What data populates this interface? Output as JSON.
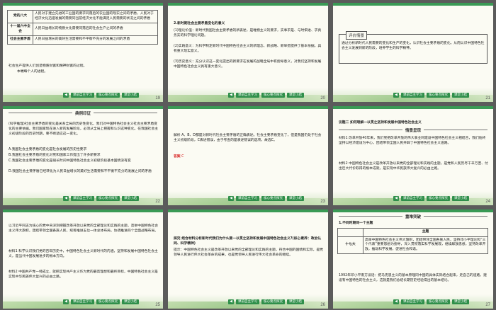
{
  "slides": [
    {
      "page": "19",
      "table": [
        {
          "head": "党的八大",
          "text": "人民对于建立先进的工业国的要求同落后的农业国的现实之间的矛盾，人民对于经济文化迅速发展的需要同当前经济文化不能满足人民需要的状况之间的矛盾"
        },
        {
          "head": "十一届六中全会",
          "text": "人民日益增长的物质文化需要同落后的社会生产之间的矛盾"
        },
        {
          "head": "社会主要矛盾",
          "text": "人民日益增长的美好生活需要和不平衡不充分的发展之间的矛盾"
        }
      ],
      "note_blue": "社会生产提供人们创造物质财富和精神财富的过程。",
      "note_red": "本端每个人的进程。"
    },
    {
      "page": "20",
      "heading": "2.新时期社会主要矛盾变化的意义",
      "lines": [
        "(1)理论价值：新时代我国社会主要矛盾的新表述，是唯物主义的要求，实事求是、与时俱进、求真务实的科学理论问题。",
        "(2)实践意义：为科学制定新时代中国特色社会主义的新理念、新战略、新举措提供了基本依据，具有重大现实意义。",
        "(3)历史意义：充分认识这一变化提出的新要求在发展的战略全局中有指导意义，对我们坚持和发展中国特色社会主义具有重大意义。"
      ]
    },
    {
      "page": "21",
      "label": "评价情景",
      "text": "通过分析新时代人民需要的变化和生产的变化，认识社会主要矛盾的变化，从而认识中国特色社会主义发展到新的阶段，培养学生的科学精神。"
    },
    {
      "page": "22",
      "ribbon": "典例印证",
      "lines": [
        "(科学推理)社会主要矛盾的变化是关系全局的历史性变化，我们对中国特色社会主义社会主要矛盾变化的主要依据。我们国家现在进入新的发展阶段，必须从全局上把握和认识这种变化，在我国社会主义初级阶段的历史时期，要不断适应这一变化。",
        "A.我国社会主要矛盾的变化是社会发展的历史性要求",
        "B.我国社会主要矛盾的变化对党和国家工作提出了许多新要求",
        "C.我国社会主要矛盾的变化是很长时间中国特色社会主义初级阶段基本国情没有变",
        "D.我国社会主要矛盾已经转化为人民日益增长的美好生活需要和不平衡不充分的发展之间的矛盾"
      ]
    },
    {
      "page": "23",
      "text_blue": "解析  A、B、D都是对新时代社会主要矛盾的正确表述。社会主要矛盾变化了，但是我国仍处于社会主义初级阶段，C表述错误，由于考查的是表述错误的选项，故选C。",
      "answer_label": "答案",
      "answer": "C"
    },
    {
      "page": "24",
      "title": "议题二  如何理解一以贯之坚持和发展中国特色社会主义",
      "ribbon": "情景呈现",
      "lines": [
        "材料1  改革开放40年来，我们党把改革开放的伟大事业同建设中国特色社会主义相结合，我们始终坚持以经济建设为中心，团结带领全国人民开辟了中国特色社会主义道路。",
        "材料2  中国特色社会主义是改革开放以来党的全部理论和实践的主题，是党和人民历尽千辛万苦、付出巨大代价取得的根本成就，是实现中华民族伟大复兴的必由之路。"
      ]
    },
    {
      "page": "25",
      "lines": [
        "以习近平同志为核心的党中央深刻把握改革开放以来党的全部理论和实践的主题，高举中国特色社会主义伟大旗帜，团结带领全国各族人民，统筹推进五位一体总体布局，协调推进四个全面战略布局。",
        "材料1  科学认识我们党的百年历史中，中国特色社会主义新时代的内涵，坚持和发展中国特色社会主义，是当代中国发展进步的根本方向。",
        "材料2  中国共产党一经成立，就把实现共产主义作为党的最高理想和最终目标，中国特色社会主义是实现中华民族伟大复兴的必由之路。"
      ]
    },
    {
      "page": "26",
      "question": "探究  结合材料分析新时代我们为什么要一以贯之坚持和发展中国特色社会主义?(核心素养：政治认同、科学精神)",
      "answer": "提示：中国特色社会主义是改革开放以来党的全部理论和实践的主题，符合中国的国情和实际，是党领导人民进行伟大社会革命的成果，也是党领导人民进行伟大社会革命的继续。"
    },
    {
      "page": "27",
      "ribbon": "重难突破",
      "heading": "1.不同时期同一个主题",
      "col_head": "主题",
      "row_head": "十七大",
      "row_text": "高举中国特色社会主义伟大旗帜，团结带领全国各族人民，坚持邓小平理论和“三个代表”重要思想为指导，深入贯彻落实科学发展观，继续解放思想，坚持改革开放，推动科学发展，促进社会和谐。",
      "note": "1992年邓小平南方谈话：把马克思主义的基本原理同中国的具体实际结合起来，走自己的道路，建设有中国特色的社会主义，这就是我们总结长期历史经验得出的基本结论。"
    }
  ],
  "nav": {
    "left_arrow": "◀",
    "right_arrow": "▶",
    "pills": [
      "课前自主学习",
      "核心要点探究",
      "课堂小结"
    ]
  }
}
